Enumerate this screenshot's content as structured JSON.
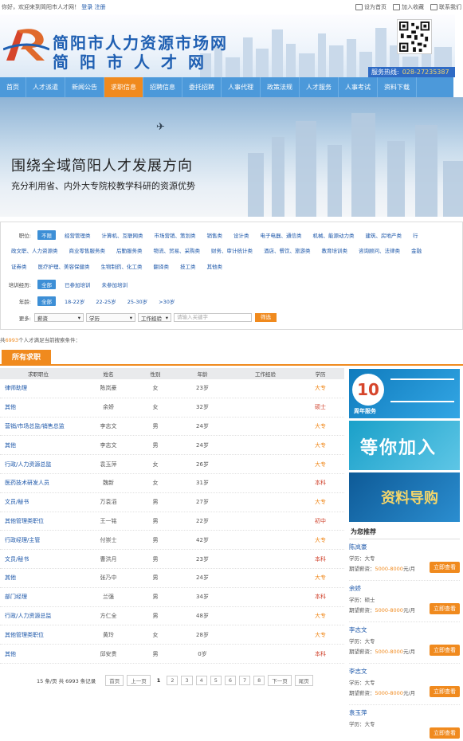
{
  "topbar": {
    "welcome": "你好，欢迎来到简阳市人才网！",
    "login": "登录",
    "register": "注册",
    "set_home": "设为首页",
    "add_fav": "加入收藏",
    "contact": "联系我们"
  },
  "header": {
    "title_line1": "简阳市人力资源市场网",
    "title_line2": "简阳市人才网",
    "hotline_label": "服务热线:",
    "hotline_number": "028-27235387"
  },
  "nav": {
    "items": [
      "首页",
      "人才派遣",
      "新闻公告",
      "求职信息",
      "招聘信息",
      "委托招聘",
      "人事代理",
      "政策法规",
      "人才服务",
      "人事考试",
      "资料下载"
    ],
    "active_index": 3
  },
  "banner": {
    "headline": "围绕全域简阳人才发展方向",
    "subline": "充分利用省、内外大专院校教学科研的资源优势"
  },
  "filter": {
    "job_label": "职位:",
    "job_selected": "不限",
    "job_row1": [
      "经营管理类",
      "计算机、互联网类",
      "市场营销、策划类",
      "销售类",
      "设计类",
      "电子电器、通信类",
      "机械、能源动力类",
      "建筑、房地产类",
      "行"
    ],
    "job_row2": [
      "政文职、人力资源类",
      "商业零售服务类",
      "后勤服务类",
      "物流、贸易、采购类",
      "财务、审计统计类",
      "酒店、餐饮、旅游类",
      "教育培训类",
      "咨询顾问、法律类",
      "金融"
    ],
    "job_row3": [
      "证券类",
      "医疗护理、美容保健类",
      "生物制药、化工类",
      "翻译类",
      "技工类",
      "其他类"
    ],
    "training_label": "培训经历:",
    "training_selected": "全部",
    "training_opts": [
      "已参加培训",
      "未参加培训"
    ],
    "age_label": "年龄:",
    "age_selected": "全部",
    "age_opts": [
      "18-22岁",
      "22-25岁",
      "25-30岁",
      ">30岁"
    ],
    "more_label": "更多:",
    "dd_salary": "薪资",
    "dd_edu": "学历",
    "dd_exp": "工作经验",
    "keyword_placeholder": "请输入关键字",
    "filter_btn": "筛选"
  },
  "count": {
    "prefix": "共",
    "num": "6993",
    "suffix": "个人才满足当前搜索条件："
  },
  "tab_title": "所有求职",
  "table": {
    "headers": [
      "求职职位",
      "姓名",
      "性别",
      "年龄",
      "工作经验",
      "学历"
    ],
    "rows": [
      {
        "job": "律师助理",
        "name": "陈岚豪",
        "gender": "女",
        "age": "23岁",
        "exp": "",
        "edu": "大专"
      },
      {
        "job": "其他",
        "name": "余娇",
        "gender": "女",
        "age": "32岁",
        "exp": "",
        "edu": "硕士"
      },
      {
        "job": "营销/市场总监/销售总监",
        "name": "李志文",
        "gender": "男",
        "age": "24岁",
        "exp": "",
        "edu": "大专"
      },
      {
        "job": "其他",
        "name": "李志文",
        "gender": "男",
        "age": "24岁",
        "exp": "",
        "edu": "大专"
      },
      {
        "job": "行政/人力资源总监",
        "name": "袁玉萍",
        "gender": "女",
        "age": "26岁",
        "exp": "",
        "edu": "大专"
      },
      {
        "job": "医药技术研发人员",
        "name": "魏新",
        "gender": "女",
        "age": "31岁",
        "exp": "",
        "edu": "本科"
      },
      {
        "job": "文员/秘书",
        "name": "万袁滔",
        "gender": "男",
        "age": "27岁",
        "exp": "",
        "edu": "大专"
      },
      {
        "job": "其他管理类职位",
        "name": "王一铭",
        "gender": "男",
        "age": "22岁",
        "exp": "",
        "edu": "初中"
      },
      {
        "job": "行政经理/主管",
        "name": "付崇士",
        "gender": "男",
        "age": "42岁",
        "exp": "",
        "edu": "大专"
      },
      {
        "job": "文员/秘书",
        "name": "曹洪月",
        "gender": "男",
        "age": "23岁",
        "exp": "",
        "edu": "本科"
      },
      {
        "job": "其他",
        "name": "张乃中",
        "gender": "男",
        "age": "24岁",
        "exp": "",
        "edu": "大专"
      },
      {
        "job": "部门经理",
        "name": "兰强",
        "gender": "男",
        "age": "34岁",
        "exp": "",
        "edu": "本科"
      },
      {
        "job": "行政/人力资源总监",
        "name": "方仁全",
        "gender": "男",
        "age": "48岁",
        "exp": "",
        "edu": "大专"
      },
      {
        "job": "其他管理类职位",
        "name": "黄玲",
        "gender": "女",
        "age": "28岁",
        "exp": "",
        "edu": "大专"
      },
      {
        "job": "其他",
        "name": "邱安贵",
        "gender": "男",
        "age": "0岁",
        "exp": "",
        "edu": "本科"
      }
    ]
  },
  "pager": {
    "info": "15 条/页 共 6993 条记录",
    "first": "首页",
    "prev": "上一页",
    "current": "1",
    "pages": [
      "2",
      "3",
      "4",
      "5",
      "6",
      "7",
      "8"
    ],
    "next": "下一页",
    "last": "尾页"
  },
  "side": {
    "ad1_text": "10",
    "ad1_sub": "周年服务",
    "ad2_text": "等你加入",
    "ad3_text": "资料导购",
    "reco_title": "为您推荐",
    "edu_label": "学历：",
    "salary_label": "期望薪资：",
    "salary_unit": "元/月",
    "view_btn": "立即查看",
    "items": [
      {
        "name": "陈岚豪",
        "edu": "大专",
        "salary": "5000-8000"
      },
      {
        "name": "余娇",
        "edu": "硕士",
        "salary": "5000-8000"
      },
      {
        "name": "李志文",
        "edu": "大专",
        "salary": "5000-8000"
      },
      {
        "name": "李志文",
        "edu": "大专",
        "salary": "5000-8000"
      },
      {
        "name": "袁玉萍",
        "edu": "大专",
        "salary": ""
      }
    ]
  },
  "colors": {
    "accent": "#f08a1e",
    "nav": "#4c99da",
    "link": "#1a55a8"
  }
}
